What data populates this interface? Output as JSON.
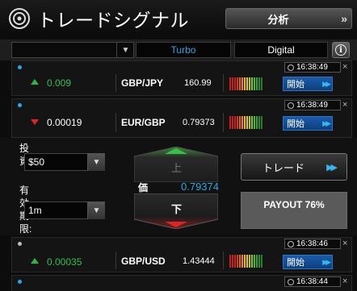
{
  "header": {
    "title": "トレードシグナル",
    "analysis_label": "分析",
    "analysis_chevron": "»"
  },
  "filter": {
    "selected": "",
    "caret": "▼",
    "tabs": [
      {
        "label": "Turbo",
        "active": true
      },
      {
        "label": "Digital",
        "active": false
      }
    ],
    "info_symbol": "i"
  },
  "signals": [
    {
      "time": "16:38:49",
      "direction": "up",
      "value": "0.009",
      "pair": "GBP/JPY",
      "price": "160.99",
      "button": "開始",
      "close": "×"
    },
    {
      "time": "16:38:49",
      "direction": "down",
      "value": "0.00019",
      "pair": "EUR/GBP",
      "price": "0.79373",
      "button": "開始",
      "close": "×"
    },
    {
      "time": "16:38:46",
      "direction": "up",
      "value": "0.00035",
      "pair": "GBP/USD",
      "price": "1.43444",
      "button": "開始",
      "close": "×"
    },
    {
      "time": "16:38:44",
      "close": "×"
    }
  ],
  "trade_panel": {
    "amount_label": "投資",
    "amount_value": "$50",
    "expiry_label": "有効期限:",
    "expiry_value": "1m",
    "up_label": "上",
    "down_label": "下",
    "price_label": "価",
    "price_value": "0.79374",
    "trade_button": "トレード",
    "payout": "PAYOUT 76%"
  },
  "colors": {
    "accent_blue": "#29a9e8",
    "up_green": "#2fc04f",
    "down_red": "#e02424",
    "dot_blue": "#29a9e8",
    "dot_gray": "#bbbbbb"
  }
}
